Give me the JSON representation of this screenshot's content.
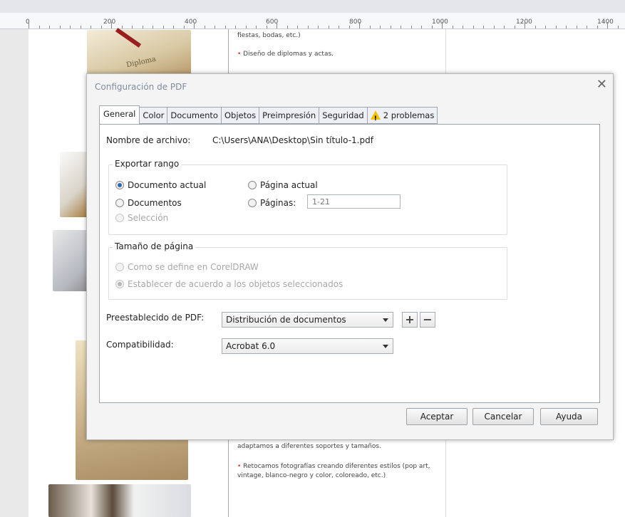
{
  "ruler": {
    "ticks": [
      "0",
      "200",
      "400",
      "600",
      "800",
      "1000",
      "1200",
      "1400"
    ]
  },
  "background_doc": {
    "text_top_1": "fiestas, bodas, etc.)",
    "text_top_2": "Diseño de diplomas y actas.",
    "text_bottom_1": "adaptamos a diferentes soportes y tamaños.",
    "text_bottom_2": "Retocamos fotografías creando diferentes estilos (pop art, vintage, blanco-negro y color, coloreado, etc.)",
    "diploma_word": "Diploma"
  },
  "dialog": {
    "title": "Configuración de PDF",
    "close": "✕",
    "tabs": [
      {
        "label": "General"
      },
      {
        "label": "Color"
      },
      {
        "label": "Documento"
      },
      {
        "label": "Objetos"
      },
      {
        "label": "Preimpresión"
      },
      {
        "label": "Seguridad"
      },
      {
        "label": "2 problemas"
      }
    ],
    "general": {
      "filename_label": "Nombre de archivo:",
      "filename_value": "C:\\Users\\ANA\\Desktop\\Sin título-1.pdf",
      "export_range": {
        "title": "Exportar rango",
        "current_doc": "Documento actual",
        "documents": "Documentos",
        "selection": "Selección",
        "current_page": "Página actual",
        "pages": "Páginas:",
        "pages_value": "1-21"
      },
      "page_size": {
        "title": "Tamaño de página",
        "as_defined": "Como se define en CorelDRAW",
        "from_objects": "Establecer de acuerdo a los objetos seleccionados"
      },
      "preset_label": "Preestablecido de PDF:",
      "preset_value": "Distribución de documentos",
      "preset_add": "+",
      "preset_remove": "−",
      "compat_label": "Compatibilidad:",
      "compat_value": "Acrobat 6.0"
    },
    "buttons": {
      "ok": "Aceptar",
      "cancel": "Cancelar",
      "help": "Ayuda"
    }
  },
  "colors": {
    "accent": "#2f65b6",
    "title_text": "#7f8da0",
    "warning": "#f0c400"
  }
}
